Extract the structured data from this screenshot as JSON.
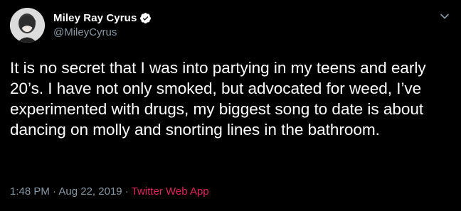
{
  "tweet": {
    "display_name": "Miley Ray Cyrus",
    "handle": "@MileyCyrus",
    "text": "It is no secret that I was into partying in my teens and early 20’s. I have not only smoked, but advocated for weed, I’ve experimented with drugs, my biggest song to date is about dancing on molly and snorting lines in the bathroom.",
    "time": "1:48 PM",
    "separator1": " · ",
    "date": "Aug 22, 2019",
    "separator2": " · ",
    "source": "Twitter Web App",
    "icons": {
      "verified": "verified-badge-icon",
      "caret": "chevron-down-icon"
    },
    "colors": {
      "background": "#000000",
      "secondary_text": "#8899a6",
      "source_link": "#e0245e",
      "verified": "#ffffff"
    }
  }
}
